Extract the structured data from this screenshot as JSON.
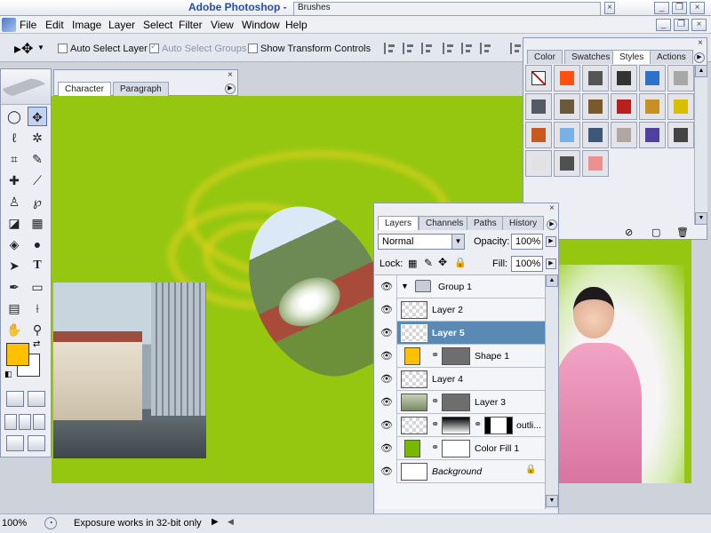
{
  "window": {
    "app_title": "Adobe Photoshop -",
    "palette_well_tab": "Brushes",
    "buttons": [
      "minimize-icon",
      "restore-icon",
      "close-icon"
    ]
  },
  "menu": {
    "items": [
      "File",
      "Edit",
      "Image",
      "Layer",
      "Select",
      "Filter",
      "View",
      "Window",
      "Help"
    ]
  },
  "options": {
    "auto_select_layer": "Auto Select Layer",
    "auto_select_groups": "Auto Select Groups",
    "show_transform_controls": "Show Transform Controls"
  },
  "character_panel": {
    "tabs": [
      "Character",
      "Paragraph"
    ]
  },
  "styles_panel": {
    "tabs": [
      "Color",
      "Swatches",
      "Styles",
      "Actions"
    ],
    "swatch_colors": [
      "#ffffff",
      "#ff5010",
      "#555555",
      "#333333",
      "#2e72c8",
      "#a8a8a8",
      "#555a66",
      "#6b5a3a",
      "#7a5a2a",
      "#b82020",
      "#c89020",
      "#d8c000",
      "#c85a20",
      "#7ab0e8",
      "#405878",
      "#b0a8a0",
      "#5040a0",
      "#444444",
      "#e2e2e2",
      "#505050",
      "#ee9090"
    ]
  },
  "layers_panel": {
    "tabs": [
      "Layers",
      "Channels",
      "Paths",
      "History"
    ],
    "blend_mode": "Normal",
    "opacity_label": "Opacity:",
    "opacity_value": "100%",
    "lock_label": "Lock:",
    "fill_label": "Fill:",
    "fill_value": "100%",
    "layers": [
      "Group 1",
      "Layer 2",
      "Layer 5",
      "Shape 1",
      "Layer 4",
      "Layer 3",
      "outli...",
      "Color Fill 1",
      "Background"
    ]
  },
  "status": {
    "zoom": "100%",
    "message": "Exposure works in 32-bit only"
  },
  "colors": {
    "foreground": "#ffc000",
    "background": "#ffffff",
    "canvas": "#95c711",
    "selection": "#5a8ab4"
  }
}
